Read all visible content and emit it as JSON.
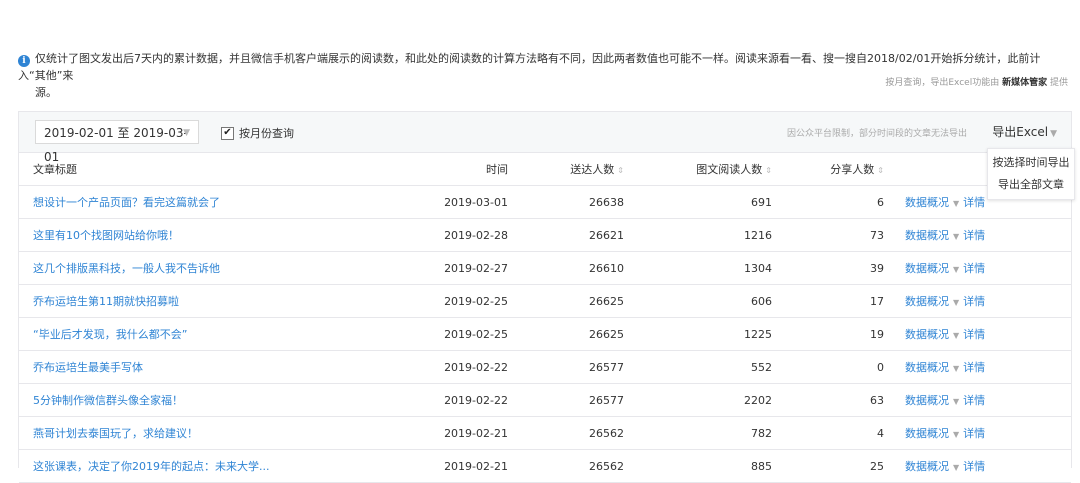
{
  "notice": {
    "icon": "info-icon",
    "line1": "仅统计了图文发出后7天内的累计数据，并且微信手机客户端展示的阅读数，和此处的阅读数的计算方法略有不同，因此两者数值也可能不一样。阅读来源看一看、搜一搜自2018/02/01开始拆分统计，此前计入“其他”来",
    "line2": "源。"
  },
  "provider": {
    "prefix": "按月查询，导出Excel功能由",
    "name": "新媒体管家",
    "suffix": "提供"
  },
  "toolbar": {
    "date_range": "2019-02-01 至 2019-03-01",
    "month_query_label": "按月份查询",
    "month_query_checked": true,
    "limit_note": "因公众平台限制，部分时间段的文章无法导出",
    "export_label": "导出Excel"
  },
  "export_menu": [
    "按选择时间导出",
    "导出全部文章"
  ],
  "table": {
    "headers": {
      "title": "文章标题",
      "time": "时间",
      "delivered": "送达人数",
      "reads": "图文阅读人数",
      "shares": "分享人数"
    },
    "op_overview": "数据概况",
    "op_detail": "详情",
    "rows": [
      {
        "title": "想设计一个产品页面？看完这篇就会了",
        "time": "2019-03-01",
        "delivered": "26638",
        "reads": "691",
        "shares": "6"
      },
      {
        "title": "这里有10个找图网站给你哦！",
        "time": "2019-02-28",
        "delivered": "26621",
        "reads": "1216",
        "shares": "73"
      },
      {
        "title": "这几个排版黑科技，一般人我不告诉他",
        "time": "2019-02-27",
        "delivered": "26610",
        "reads": "1304",
        "shares": "39"
      },
      {
        "title": "乔布运培生第11期就快招募啦",
        "time": "2019-02-25",
        "delivered": "26625",
        "reads": "606",
        "shares": "17"
      },
      {
        "title": "“毕业后才发现，我什么都不会”",
        "time": "2019-02-25",
        "delivered": "26625",
        "reads": "1225",
        "shares": "19"
      },
      {
        "title": "乔布运培生最美手写体",
        "time": "2019-02-22",
        "delivered": "26577",
        "reads": "552",
        "shares": "0"
      },
      {
        "title": "5分钟制作微信群头像全家福！",
        "time": "2019-02-22",
        "delivered": "26577",
        "reads": "2202",
        "shares": "63"
      },
      {
        "title": "燕哥计划去泰国玩了，求给建议！",
        "time": "2019-02-21",
        "delivered": "26562",
        "reads": "782",
        "shares": "4"
      },
      {
        "title": "这张课表，决定了你2019年的起点：未来大学...",
        "time": "2019-02-21",
        "delivered": "26562",
        "reads": "885",
        "shares": "25"
      }
    ]
  }
}
